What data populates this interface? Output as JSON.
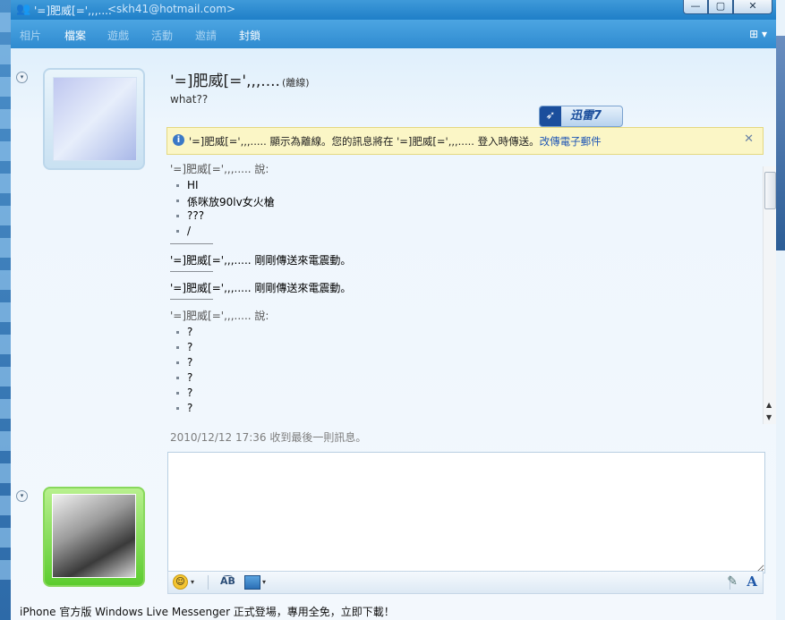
{
  "window": {
    "title": "'=]肥威[=',,,....",
    "email": "<skh41@hotmail.com>",
    "controls": {
      "minimize": "—",
      "maximize": "▢",
      "close": "✕"
    }
  },
  "menu": {
    "items": [
      {
        "label": "相片",
        "active": false
      },
      {
        "label": "檔案",
        "active": true
      },
      {
        "label": "遊戲",
        "active": false
      },
      {
        "label": "活動",
        "active": false
      },
      {
        "label": "邀請",
        "active": false
      },
      {
        "label": "封鎖",
        "active": true
      }
    ],
    "options_icon": "⊞ ▾"
  },
  "contact": {
    "name": "'=]肥威[=',,,....",
    "status": "(離線)",
    "personal_message": "what??"
  },
  "overlay_badge": {
    "text": "迅雷7",
    "icon": "bird-icon"
  },
  "info_bar": {
    "text": "'=]肥威[=',,,..... 顯示為離線。您的訊息將在 '=]肥威[=',,,..... 登入時傳送。",
    "link": "改傳電子郵件",
    "close": "✕"
  },
  "history": {
    "blocks": [
      {
        "says": "'=]肥威[=',,,..... 說:",
        "messages": [
          "HI",
          "係咪放90lv女火槍",
          "???",
          "/"
        ]
      },
      {
        "nudge": "'=]肥威[=',,,..... 剛剛傳送來電震動。"
      },
      {
        "nudge": "'=]肥威[=',,,..... 剛剛傳送來電震動。"
      },
      {
        "says": "'=]肥威[=',,,..... 說:",
        "messages": [
          "?",
          "?",
          "?",
          "?",
          "?",
          "?"
        ]
      }
    ]
  },
  "last_received": "2010/12/12 17:36 收到最後一則訊息。",
  "compose": {
    "value": ""
  },
  "toolbar": {
    "spell_label": "A͡B",
    "font_label": "A",
    "caret": "▾"
  },
  "ad_text": "iPhone 官方版 Windows Live Messenger 正式登場，專用全免，立即下載！",
  "colors": {
    "titlebar": "#1f7fc8",
    "info_bg": "#fbf6c6",
    "link": "#1f56b5"
  }
}
